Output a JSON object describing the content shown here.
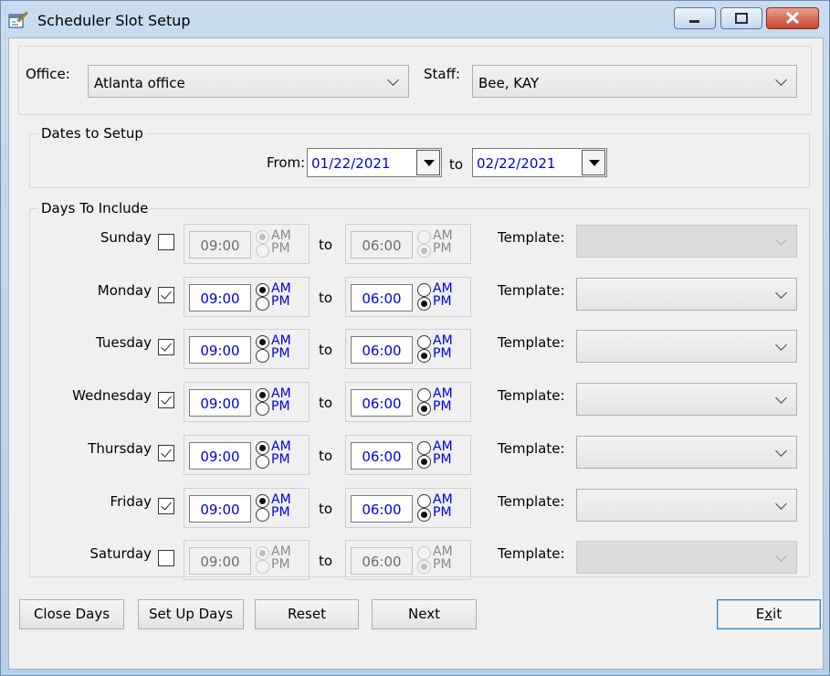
{
  "window": {
    "title": "Scheduler Slot Setup"
  },
  "office": {
    "label": "Office:",
    "value": "Atlanta office"
  },
  "staff": {
    "label": "Staff:",
    "value": "Bee, KAY"
  },
  "dates": {
    "group_label": "Dates to Setup",
    "from_label": "From:",
    "from_value": "01/22/2021",
    "to_label": "to",
    "to_value": "02/22/2021"
  },
  "days": {
    "group_label": "Days To Include",
    "to_label": "to",
    "template_label": "Template:",
    "am": "AM",
    "pm": "PM",
    "rows": [
      {
        "name": "Sunday",
        "checked": false,
        "start": "09:00",
        "start_ampm": "AM",
        "end": "06:00",
        "end_ampm": "PM"
      },
      {
        "name": "Monday",
        "checked": true,
        "start": "09:00",
        "start_ampm": "AM",
        "end": "06:00",
        "end_ampm": "PM"
      },
      {
        "name": "Tuesday",
        "checked": true,
        "start": "09:00",
        "start_ampm": "AM",
        "end": "06:00",
        "end_ampm": "PM"
      },
      {
        "name": "Wednesday",
        "checked": true,
        "start": "09:00",
        "start_ampm": "AM",
        "end": "06:00",
        "end_ampm": "PM"
      },
      {
        "name": "Thursday",
        "checked": true,
        "start": "09:00",
        "start_ampm": "AM",
        "end": "06:00",
        "end_ampm": "PM"
      },
      {
        "name": "Friday",
        "checked": true,
        "start": "09:00",
        "start_ampm": "AM",
        "end": "06:00",
        "end_ampm": "PM"
      },
      {
        "name": "Saturday",
        "checked": false,
        "start": "09:00",
        "start_ampm": "AM",
        "end": "06:00",
        "end_ampm": "PM"
      }
    ]
  },
  "buttons": {
    "close_days": "Close Days",
    "set_up_days": "Set Up  Days",
    "reset": "Reset",
    "next": "Next",
    "exit_pre": "E",
    "exit_ul": "x",
    "exit_post": "it"
  },
  "icons": {
    "app": "calendar-app-icon",
    "min": "minimize-icon",
    "max": "maximize-icon",
    "close": "close-icon"
  },
  "colors": {
    "value_text": "#0000e0",
    "close_button": "#c8452d",
    "title_bar": "#c9dcef"
  }
}
